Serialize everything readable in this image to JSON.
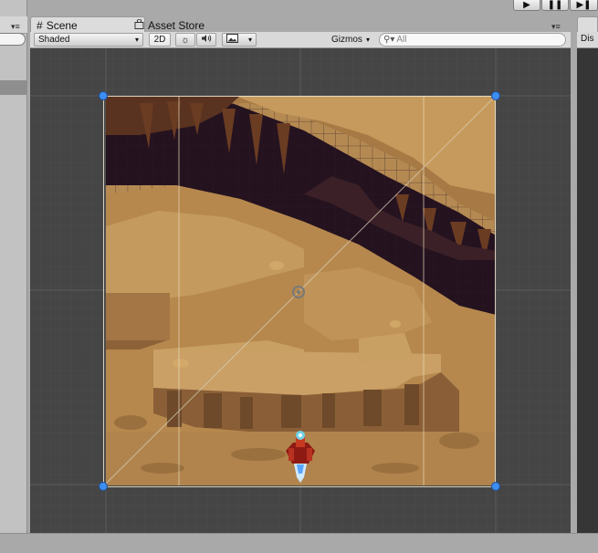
{
  "scene_tab": {
    "label": "Scene",
    "icon": "grid-icon"
  },
  "asset_store_tab": {
    "label": "Asset Store",
    "icon": "shopping-bag-icon"
  },
  "toolbar": {
    "draw_mode": "Shaded",
    "mode_2d": "2D",
    "lighting_icon": "sun-icon",
    "audio_icon": "speaker-icon",
    "effects_icon": "image-icon",
    "gizmos": "Gizmos",
    "search_placeholder": "All"
  },
  "right_panel": {
    "tab_label": "Dis"
  },
  "play_controls": {
    "play": "▶",
    "pause": "❚❚",
    "step": "▶❚"
  },
  "colors": {
    "scene_bg": "#454545",
    "sand_light": "#c79a5e",
    "sand_mid": "#a87c47",
    "sand_dark": "#7a5430",
    "cave_dark": "#24121f",
    "handle_blue": "#3d8ef0"
  }
}
